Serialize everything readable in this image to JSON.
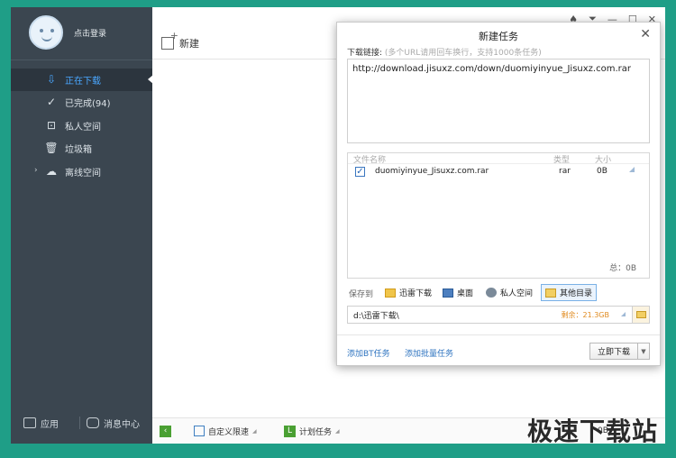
{
  "sidebar": {
    "login_label": "点击登录",
    "items": [
      {
        "label": "正在下载",
        "icon": "download-arrow-icon",
        "glyph": "⇩"
      },
      {
        "label": "已完成(94)",
        "icon": "check-circle-icon",
        "glyph": "✓"
      },
      {
        "label": "私人空间",
        "icon": "lock-icon",
        "glyph": "⊡"
      },
      {
        "label": "垃圾箱",
        "icon": "trash-icon",
        "glyph": "🗑"
      },
      {
        "label": "离线空间",
        "icon": "cloud-icon",
        "glyph": "☁"
      }
    ],
    "bottom": {
      "apps_label": "应用",
      "messages_label": "消息中心"
    }
  },
  "main": {
    "new_label": "新建",
    "window_controls": [
      "♠",
      "⏷",
      "—",
      "☐",
      "✕"
    ]
  },
  "statusbar": {
    "speed_label": "自定义限速",
    "plan_label": "计划任务",
    "right_text": "0B",
    "watermark": "极速下载站"
  },
  "dialog": {
    "title": "新建任务",
    "link_label": "下载链接:",
    "link_hint": "(多个URL请用回车换行，支持1000条任务)",
    "url": "http://download.jisuxz.com/down/duomiyinyue_Jisuxz.com.rar",
    "table": {
      "headers": {
        "name": "文件名称",
        "type": "类型",
        "size": "大小"
      },
      "rows": [
        {
          "checked": "✓",
          "name": "duomiyinyue_Jisuxz.com.rar",
          "type": "rar",
          "size": "0B"
        }
      ],
      "total": "总：0B"
    },
    "save_to": {
      "label": "保存到",
      "options": [
        "迅雷下载",
        "桌面",
        "私人空间",
        "其他目录"
      ]
    },
    "path": {
      "value": "d:\\迅雷下载\\",
      "free": "剩余：21.3GB"
    },
    "links": {
      "bt": "添加BT任务",
      "batch": "添加批量任务"
    },
    "download_button": "立即下载"
  }
}
